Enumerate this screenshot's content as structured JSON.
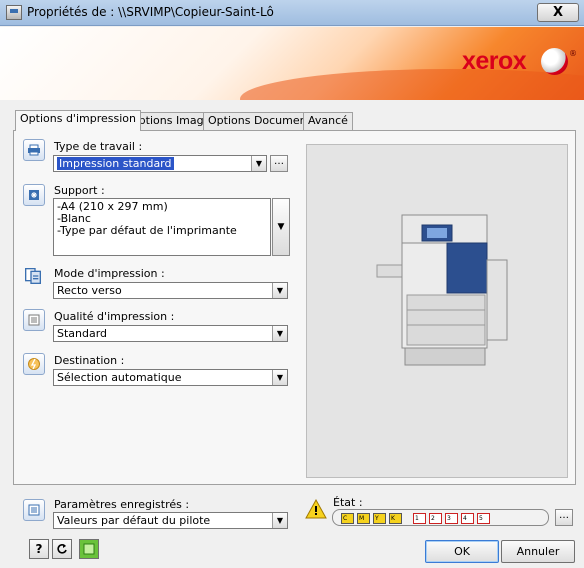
{
  "window": {
    "title": "Propriétés de : \\\\SRVIMP\\Copieur-Saint-Lô",
    "close_label": "X"
  },
  "banner": {
    "brand": "xerox",
    "registered": "®"
  },
  "tabs": [
    {
      "label": "Options d'impression",
      "active": true
    },
    {
      "label": "Options Image",
      "active": false
    },
    {
      "label": "Options Document",
      "active": false
    },
    {
      "label": "Avancé",
      "active": false
    }
  ],
  "job_type": {
    "label": "Type de travail :",
    "value": "Impression standard",
    "more_label": "…"
  },
  "paper": {
    "label": "Support :",
    "lines": [
      "-A4 (210 x 297 mm)",
      "-Blanc",
      "-Type par défaut de l'imprimante"
    ]
  },
  "print_mode": {
    "label": "Mode d'impression :",
    "value": "Recto verso"
  },
  "print_quality": {
    "label": "Qualité d'impression :",
    "value": "Standard"
  },
  "destination": {
    "label": "Destination :",
    "value": "Sélection automatique"
  },
  "saved_settings": {
    "label": "Paramètres enregistrés :",
    "value": "Valeurs par défaut du pilote"
  },
  "status": {
    "label": "État :",
    "toners": [
      "C",
      "M",
      "Y",
      "K"
    ],
    "trays": [
      "1",
      "2",
      "3",
      "4",
      "5"
    ],
    "more_label": "…"
  },
  "buttons": {
    "help": "?",
    "ok": "OK",
    "cancel": "Annuler"
  },
  "colors": {
    "accent": "#d9001c",
    "selection": "#2b55c8",
    "banner_orange": "#f7872d"
  }
}
